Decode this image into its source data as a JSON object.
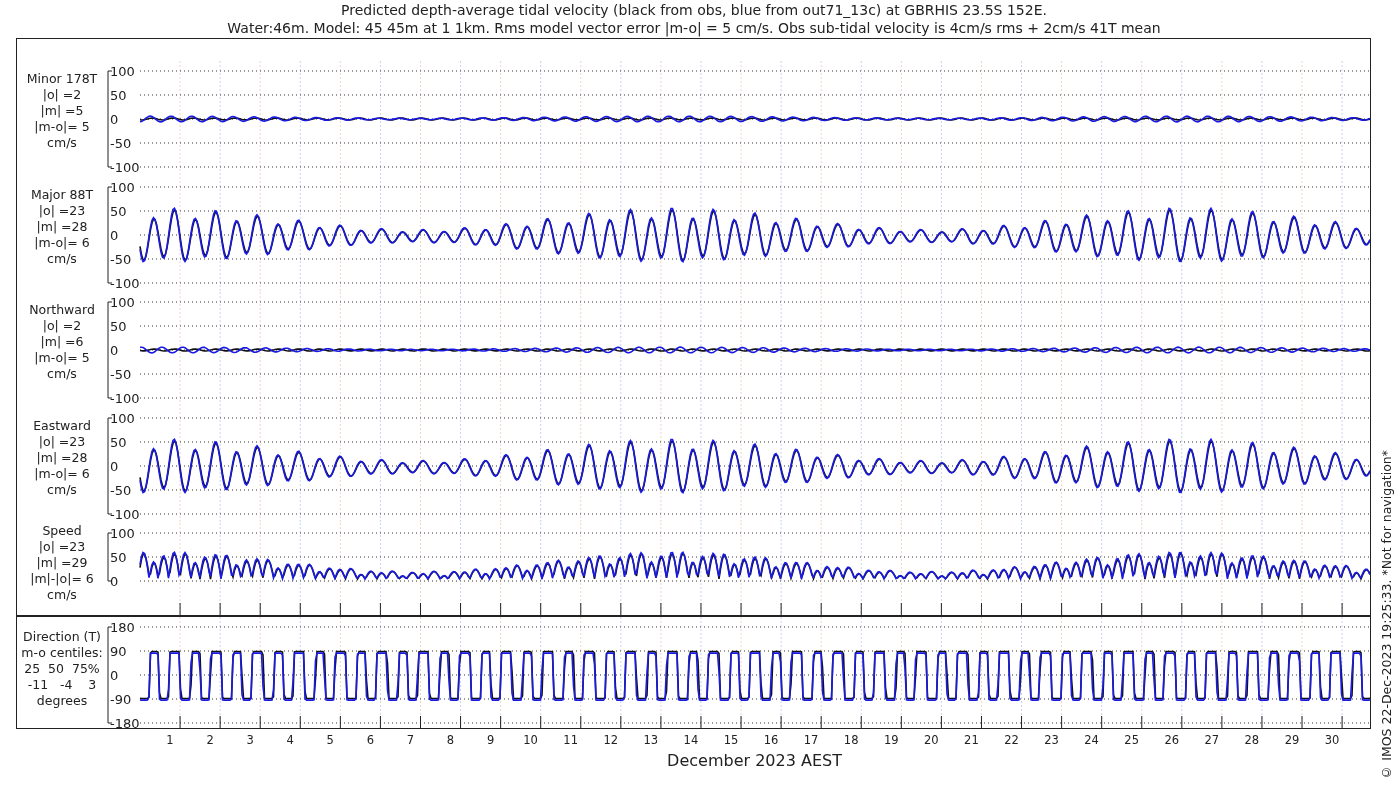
{
  "title": [
    "Predicted depth-average tidal velocity (black from obs, blue from out71_13c) at GBRHIS 23.5S 152E.",
    "Water:46m. Model: 45 45m at 1 1km. Rms model vector error |m-o| = 5 cm/s. Obs sub-tidal velocity is 4cm/s rms + 2cm/s 41T mean"
  ],
  "panels": [
    {
      "kind": "minor",
      "label": [
        "Minor 178T",
        "|o| =2",
        "|m| =5",
        "|m-o|= 5",
        "cm/s"
      ],
      "yticks": [
        "100",
        "50",
        "0",
        "-50",
        "-100"
      ]
    },
    {
      "kind": "major",
      "label": [
        "Major 88T",
        "|o| =23",
        "|m| =28",
        "|m-o|= 6",
        "cm/s"
      ],
      "yticks": [
        "100",
        "50",
        "0",
        "-50",
        "-100"
      ]
    },
    {
      "kind": "northward",
      "label": [
        "Northward",
        "|o| =2",
        "|m| =6",
        "|m-o|= 5",
        "cm/s"
      ],
      "yticks": [
        "100",
        "50",
        "0",
        "-50",
        "-100"
      ]
    },
    {
      "kind": "eastward",
      "label": [
        "Eastward",
        "|o| =23",
        "|m| =28",
        "|m-o|= 6",
        "cm/s"
      ],
      "yticks": [
        "100",
        "50",
        "0",
        "-50",
        "-100"
      ]
    },
    {
      "kind": "speed",
      "label": [
        "Speed",
        "|o| =23",
        "|m| =29",
        "|m|-|o|= 6",
        "cm/s"
      ],
      "yticks": [
        "100",
        "50",
        "0"
      ]
    },
    {
      "kind": "direction",
      "label": [
        "Direction (T)",
        "m-o centiles:",
        "25  50  75%",
        "-11   -4    3",
        "degrees"
      ],
      "yticks": [
        "180",
        "90",
        "0",
        "-90",
        "-180"
      ]
    }
  ],
  "xticks": [
    "1",
    "2",
    "3",
    "4",
    "5",
    "6",
    "7",
    "8",
    "9",
    "10",
    "11",
    "12",
    "13",
    "14",
    "15",
    "16",
    "17",
    "18",
    "19",
    "20",
    "21",
    "22",
    "23",
    "24",
    "25",
    "26",
    "27",
    "28",
    "29",
    "30"
  ],
  "xlabel": "December 2023 AEST",
  "credit": "© IMOS 22-Dec-2023 19:25:33. *Not for navigation*"
}
